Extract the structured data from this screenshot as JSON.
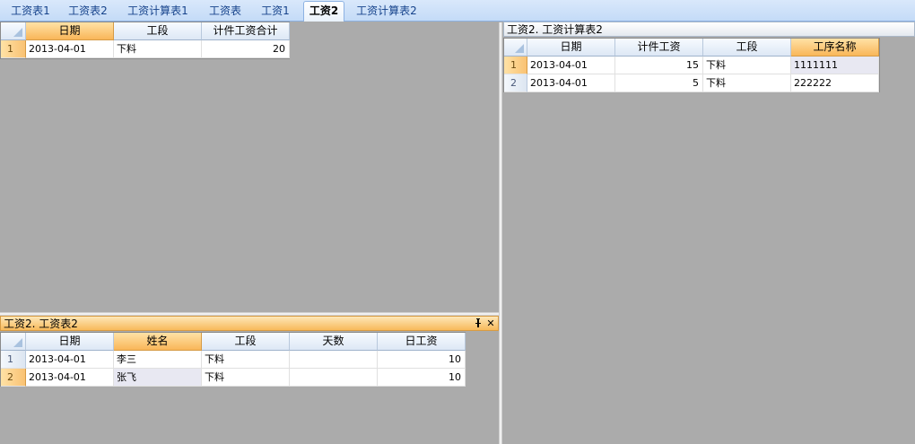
{
  "tabs": [
    {
      "label": "工资表1"
    },
    {
      "label": "工资表2"
    },
    {
      "label": "工资计算表1"
    },
    {
      "label": "工资表"
    },
    {
      "label": "工资1"
    },
    {
      "label": "工资2"
    },
    {
      "label": "工资计算表2"
    }
  ],
  "active_tab": "工资2",
  "grid_summary": {
    "columns": [
      "日期",
      "工段",
      "计件工资合计"
    ],
    "rows": [
      {
        "num": "1",
        "cells": [
          "2013-04-01",
          "下料",
          "20"
        ]
      }
    ]
  },
  "panel_calc": {
    "title": "工资2. 工资计算表2",
    "columns": [
      "日期",
      "计件工资",
      "工段",
      "工序名称"
    ],
    "rows": [
      {
        "num": "1",
        "cells": [
          "2013-04-01",
          "15",
          "下料",
          "1111111"
        ]
      },
      {
        "num": "2",
        "cells": [
          "2013-04-01",
          "5",
          "下料",
          "222222"
        ]
      }
    ]
  },
  "panel_salary": {
    "title": "工资2. 工资表2",
    "pin_glyph": "ᵖ",
    "close_glyph": "✕",
    "columns": [
      "日期",
      "姓名",
      "工段",
      "天数",
      "日工资"
    ],
    "rows": [
      {
        "num": "1",
        "cells": [
          "2013-04-01",
          "李三",
          "下料",
          "",
          "10"
        ]
      },
      {
        "num": "2",
        "cells": [
          "2013-04-01",
          "张飞",
          "下料",
          "",
          "10"
        ]
      }
    ]
  },
  "icons": {
    "pin": "pin-icon",
    "close": "close-icon"
  },
  "colors": {
    "accent_orange": "#f9b659",
    "tab_blue": "#c4dbf7",
    "workspace_gray": "#ababab"
  }
}
